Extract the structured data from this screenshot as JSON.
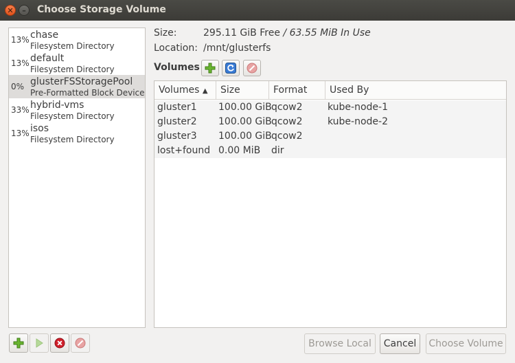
{
  "window": {
    "title": "Choose Storage Volume"
  },
  "pools": [
    {
      "percent": "13%",
      "name": "chase",
      "type": "Filesystem Directory",
      "selected": false
    },
    {
      "percent": "13%",
      "name": "default",
      "type": "Filesystem Directory",
      "selected": false
    },
    {
      "percent": "0%",
      "name": "glusterFSStoragePool",
      "type": "Pre-Formatted Block Device",
      "selected": true
    },
    {
      "percent": "33%",
      "name": "hybrid-vms",
      "type": "Filesystem Directory",
      "selected": false
    },
    {
      "percent": "13%",
      "name": "isos",
      "type": "Filesystem Directory",
      "selected": false
    }
  ],
  "info": {
    "size_label": "Size:",
    "size_free": "295.11 GiB Free",
    "size_sep": " / ",
    "size_inuse": "63.55 MiB In Use",
    "location_label": "Location:",
    "location_value": "/mnt/glusterfs"
  },
  "volumes": {
    "heading": "Volumes",
    "columns": [
      "Volumes",
      "Size",
      "Format",
      "Used By"
    ],
    "sort_indicator": "▲",
    "rows": [
      {
        "name": "gluster1",
        "size": "100.00 GiB",
        "format": "qcow2",
        "used_by": "kube-node-1"
      },
      {
        "name": "gluster2",
        "size": "100.00 GiB",
        "format": "qcow2",
        "used_by": "kube-node-2"
      },
      {
        "name": "gluster3",
        "size": "100.00 GiB",
        "format": "qcow2",
        "used_by": ""
      },
      {
        "name": "lost+found",
        "size": "0.00 MiB",
        "format": "dir",
        "used_by": ""
      }
    ]
  },
  "buttons": {
    "browse_local": "Browse Local",
    "cancel": "Cancel",
    "choose_volume": "Choose Volume"
  },
  "icons": {
    "add": "add-icon",
    "refresh": "refresh-icon",
    "delete": "delete-icon",
    "start": "play-icon",
    "stop": "stop-icon",
    "green": "#5aa02c",
    "blue": "#3a7bd5",
    "red": "#d0202b"
  }
}
